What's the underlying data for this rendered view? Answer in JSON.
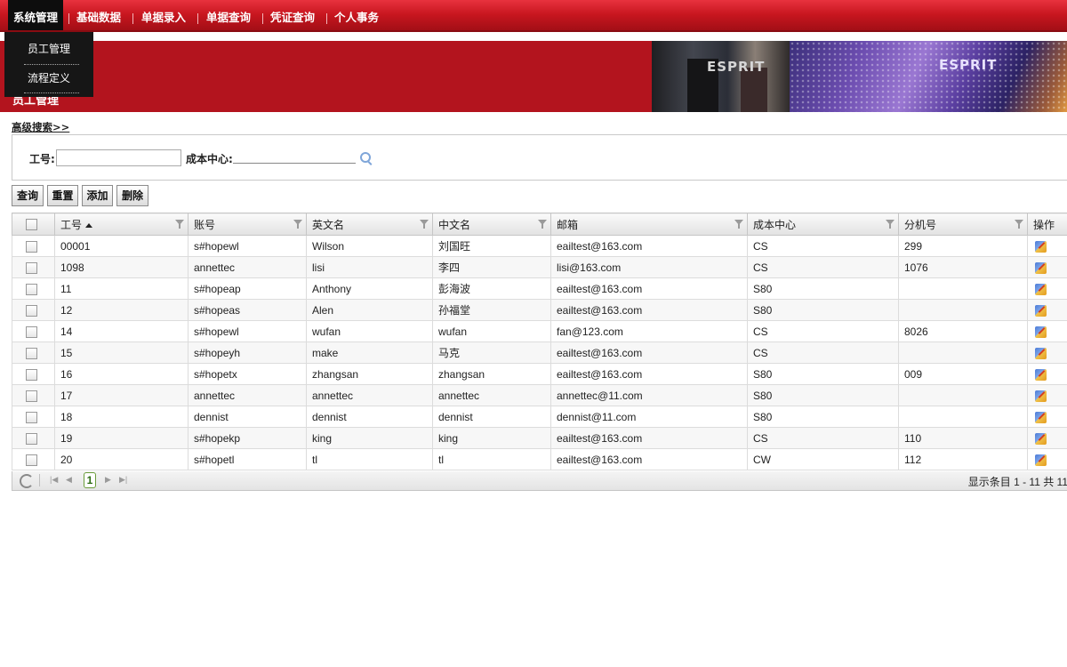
{
  "nav": {
    "items": [
      "系统管理",
      "基础数据",
      "单据录入",
      "单据查询",
      "凭证查询",
      "个人事务"
    ]
  },
  "dropdown": {
    "items": [
      "员工管理",
      "流程定义"
    ]
  },
  "banner": {
    "title": "员工管理",
    "logo1": "ESPRIT",
    "logo2": "ESPRIT"
  },
  "advanced_search": "高级搜索>>",
  "search": {
    "emp_no_label": "工号:",
    "emp_no_value": "",
    "cost_center_label": "成本中心:",
    "cost_center_value": ""
  },
  "buttons": {
    "query": "查询",
    "reset": "重置",
    "add": "添加",
    "delete": "删除"
  },
  "grid": {
    "columns": [
      "工号",
      "账号",
      "英文名",
      "中文名",
      "邮箱",
      "成本中心",
      "分机号",
      "操作"
    ],
    "rows": [
      [
        "00001",
        "s#hopewl",
        "Wilson",
        "刘国旺",
        "eailtest@163.com",
        "CS",
        "299"
      ],
      [
        "1098",
        "annettec",
        "lisi",
        "李四",
        "lisi@163.com",
        "CS",
        "1076"
      ],
      [
        "11",
        "s#hopeap",
        "Anthony",
        "彭海波",
        "eailtest@163.com",
        "S80",
        ""
      ],
      [
        "12",
        "s#hopeas",
        "Alen",
        "孙福堂",
        "eailtest@163.com",
        "S80",
        ""
      ],
      [
        "14",
        "s#hopewl",
        "wufan",
        "wufan",
        "fan@123.com",
        "CS",
        "8026"
      ],
      [
        "15",
        "s#hopeyh",
        "make",
        "马克",
        "eailtest@163.com",
        "CS",
        ""
      ],
      [
        "16",
        "s#hopetx",
        "zhangsan",
        "zhangsan",
        "eailtest@163.com",
        "S80",
        "009"
      ],
      [
        "17",
        "annettec",
        "annettec",
        "annettec",
        "annettec@11.com",
        "S80",
        ""
      ],
      [
        "18",
        "dennist",
        "dennist",
        "dennist",
        "dennist@11.com",
        "S80",
        ""
      ],
      [
        "19",
        "s#hopekp",
        "king",
        "king",
        "eailtest@163.com",
        "CS",
        "110"
      ],
      [
        "20",
        "s#hopetl",
        "tl",
        "tl",
        "eailtest@163.com",
        "CW",
        "112"
      ]
    ]
  },
  "pager": {
    "current_page": "1",
    "summary": "显示条目 1 - 11 共 11"
  }
}
